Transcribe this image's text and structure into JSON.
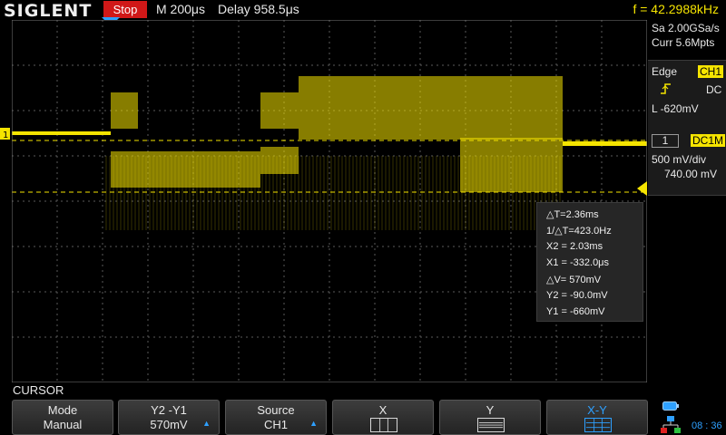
{
  "header": {
    "brand": "SIGLENT",
    "run_status": "Stop",
    "timebase": "M 200μs",
    "delay": "Delay 958.5μs",
    "frequency": "f = 42.2988kHz"
  },
  "acquisition": {
    "sample_rate": "Sa 2.00GSa/s",
    "memory": "Curr 5.6Mpts"
  },
  "trigger": {
    "type": "Edge",
    "source": "CH1",
    "coupling": "DC",
    "level": "L  -620mV",
    "slope_icon": "rising-edge-icon"
  },
  "channel": {
    "number": "1",
    "coupling": "DC1M",
    "scale": "500 mV/div",
    "offset": "740.00 mV",
    "color": "#f5e400"
  },
  "cursor_readout": {
    "delta_t": "△T=2.36ms",
    "inv_delta_t": "1/△T=423.0Hz",
    "x2": "X2 = 2.03ms",
    "x1": "X1 = -332.0μs",
    "delta_v": "△V= 570mV",
    "y2": "Y2 = -90.0mV",
    "y1": "Y1 = -660mV"
  },
  "menu": {
    "title": "CURSOR",
    "keys": [
      {
        "top": "Mode",
        "bottom": "Manual"
      },
      {
        "top": "Y2 -Y1",
        "bottom": "570mV"
      },
      {
        "top": "Source",
        "bottom": "CH1"
      },
      {
        "top": "X",
        "icon": "x-cursor-icon"
      },
      {
        "top": "Y",
        "icon": "y-cursor-icon"
      },
      {
        "top": "X-Y",
        "icon": "xy-cursor-icon",
        "active": true
      }
    ]
  },
  "status": {
    "time": "08 : 36",
    "icons": [
      "battery-icon",
      "network-icon"
    ]
  }
}
